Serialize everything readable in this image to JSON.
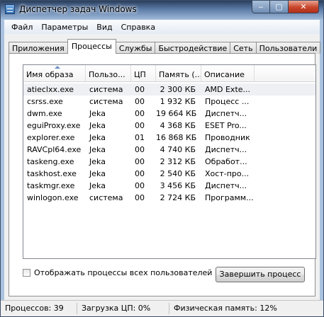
{
  "window": {
    "title": "Диспетчер задач Windows",
    "minimize": "‒",
    "maximize": "▢",
    "close": "✕"
  },
  "menu": [
    "Файл",
    "Параметры",
    "Вид",
    "Справка"
  ],
  "tabs": [
    "Приложения",
    "Процессы",
    "Службы",
    "Быстродействие",
    "Сеть",
    "Пользователи"
  ],
  "active_tab": "Процессы",
  "table": {
    "columns": [
      "Имя образа",
      "Пользо...",
      "ЦП",
      "Память (...",
      "Описание"
    ],
    "rows": [
      {
        "name": "atieclxx.exe",
        "user": "система",
        "cpu": "00",
        "mem": "2 300 КБ",
        "desc": "AMD Exte..."
      },
      {
        "name": "csrss.exe",
        "user": "система",
        "cpu": "00",
        "mem": "1 932 КБ",
        "desc": "Процесс ..."
      },
      {
        "name": "dwm.exe",
        "user": "Jeka",
        "cpu": "00",
        "mem": "19 664 КБ",
        "desc": "Диспетч..."
      },
      {
        "name": "eguiProxy.exe",
        "user": "Jeka",
        "cpu": "00",
        "mem": "4 368 КБ",
        "desc": "ESET Pro..."
      },
      {
        "name": "explorer.exe",
        "user": "Jeka",
        "cpu": "01",
        "mem": "16 868 КБ",
        "desc": "Проводник"
      },
      {
        "name": "RAVCpl64.exe",
        "user": "Jeka",
        "cpu": "00",
        "mem": "4 740 КБ",
        "desc": "Диспетч..."
      },
      {
        "name": "taskeng.exe",
        "user": "Jeka",
        "cpu": "00",
        "mem": "2 312 КБ",
        "desc": "Обработ..."
      },
      {
        "name": "taskhost.exe",
        "user": "Jeka",
        "cpu": "00",
        "mem": "2 540 КБ",
        "desc": "Хост-про..."
      },
      {
        "name": "taskmgr.exe",
        "user": "Jeka",
        "cpu": "00",
        "mem": "3 456 КБ",
        "desc": "Диспетч..."
      },
      {
        "name": "winlogon.exe",
        "user": "система",
        "cpu": "00",
        "mem": "2 724 КБ",
        "desc": "Программ..."
      }
    ]
  },
  "show_all_label": "Отображать процессы всех пользователей",
  "show_all_checked": false,
  "end_process_label": "Завершить процесс",
  "status": {
    "processes": "Процессов: 39",
    "cpu": "Загрузка ЦП: 0%",
    "memory": "Физическая память: 12%"
  }
}
